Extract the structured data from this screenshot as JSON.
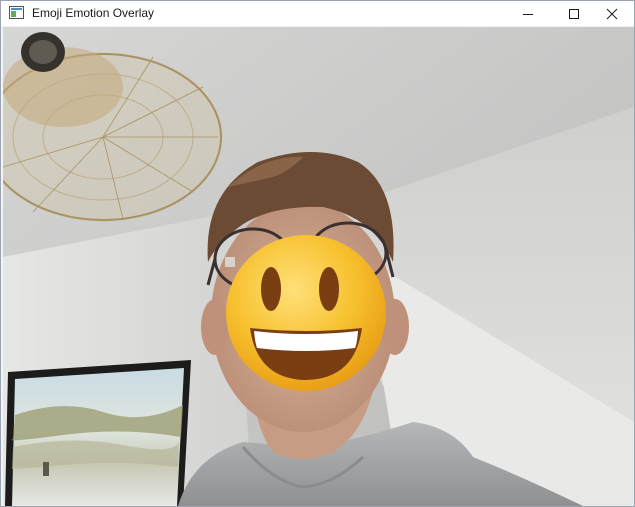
{
  "window": {
    "title": "Emoji Emotion Overlay",
    "icon": "app-window-icon",
    "controls": {
      "minimize_icon": "minimize-icon",
      "maximize_icon": "maximize-icon",
      "close_icon": "close-icon"
    }
  },
  "overlay": {
    "emotion": "happy",
    "emoji": "grinning-face-with-big-eyes"
  },
  "colors": {
    "titlebar_bg": "#ffffff",
    "wall": "#d9d9d8",
    "emoji_face": "#f5b323",
    "emoji_mouth": "#7a3e12"
  }
}
